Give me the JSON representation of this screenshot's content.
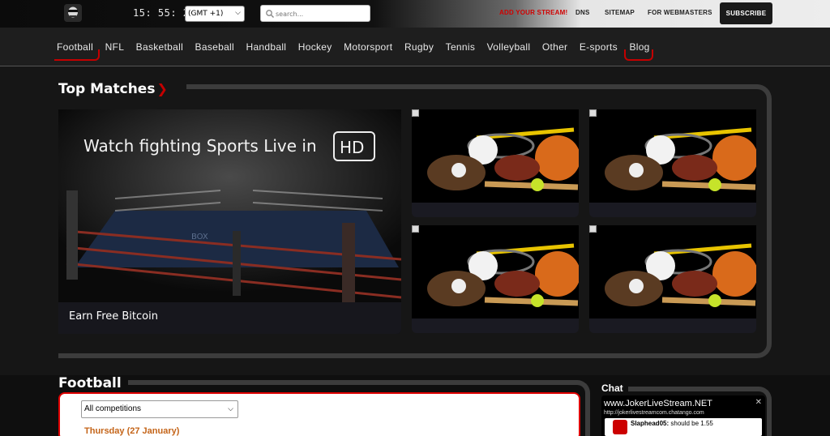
{
  "header": {
    "clock": "15: 55: 20",
    "timezone": "(GMT +1)",
    "search_placeholder": "search...",
    "links": {
      "add_stream": "ADD YOUR STREAM!",
      "dns": "DNS",
      "sitemap": "SITEMAP",
      "webmasters": "FOR WEBMASTERS"
    },
    "subscribe": "SUBSCRIBE"
  },
  "nav": {
    "items": [
      "Football",
      "NFL",
      "Basketball",
      "Baseball",
      "Handball",
      "Hockey",
      "Motorsport",
      "Rugby",
      "Tennis",
      "Volleyball",
      "Other",
      "E-sports",
      "Blog"
    ]
  },
  "top_matches": {
    "title": "Top Matches",
    "feature": {
      "banner_text": "Watch fighting Sports Live in",
      "banner_badge": "HD",
      "ring_text": "BOX",
      "caption": "Earn Free Bitcoin"
    }
  },
  "football": {
    "title": "Football",
    "competition_select": "All competitions",
    "date_heading": "Thursday (27 January)"
  },
  "chat": {
    "title": "Chat",
    "room_name": "www.JokerLiveStream.NET",
    "room_url": "http://jokerlivestreamcom.chatango.com",
    "message_user": "Slaphead05:",
    "message_text": "should be 1.55"
  },
  "colors": {
    "accent_red": "#c40000",
    "date_orange": "#c46418",
    "frame_gray": "#3c3c3c"
  }
}
